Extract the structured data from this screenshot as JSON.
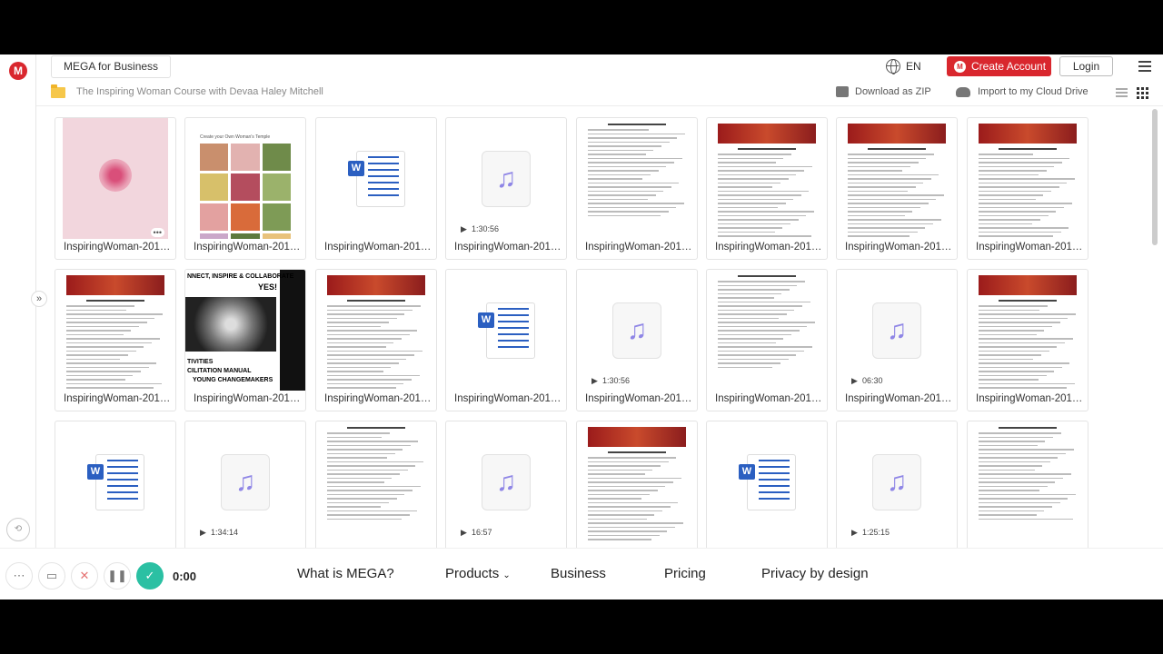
{
  "header": {
    "brand_chip": "MEGA for Business",
    "language": "EN",
    "create_account": "Create Account",
    "login": "Login"
  },
  "breadcrumb": {
    "folder_title": "The Inspiring Woman Course with Devaa Haley Mitchell",
    "download_zip": "Download as ZIP",
    "import": "Import to my Cloud Drive"
  },
  "files": [
    {
      "name": "InspiringWoman-201…",
      "kind": "pink-doc"
    },
    {
      "name": "InspiringWoman-201…",
      "kind": "photos"
    },
    {
      "name": "InspiringWoman-201…",
      "kind": "word"
    },
    {
      "name": "InspiringWoman-201…",
      "kind": "audio",
      "duration": "1:30:56"
    },
    {
      "name": "InspiringWoman-201…",
      "kind": "doc"
    },
    {
      "name": "InspiringWoman-201…",
      "kind": "banner-doc"
    },
    {
      "name": "InspiringWoman-201…",
      "kind": "banner-doc"
    },
    {
      "name": "InspiringWoman-201…",
      "kind": "banner-doc"
    },
    {
      "name": "InspiringWoman-201…",
      "kind": "banner-doc"
    },
    {
      "name": "InspiringWoman-201…",
      "kind": "collage"
    },
    {
      "name": "InspiringWoman-201…",
      "kind": "banner-doc"
    },
    {
      "name": "InspiringWoman-201…",
      "kind": "word"
    },
    {
      "name": "InspiringWoman-201…",
      "kind": "audio",
      "duration": "1:30:56"
    },
    {
      "name": "InspiringWoman-201…",
      "kind": "doc"
    },
    {
      "name": "InspiringWoman-201…",
      "kind": "audio",
      "duration": "06:30"
    },
    {
      "name": "InspiringWoman-201…",
      "kind": "banner-doc"
    },
    {
      "name": "",
      "kind": "word"
    },
    {
      "name": "",
      "kind": "audio",
      "duration": "1:34:14"
    },
    {
      "name": "",
      "kind": "doc"
    },
    {
      "name": "",
      "kind": "audio",
      "duration": "16:57"
    },
    {
      "name": "",
      "kind": "banner-doc"
    },
    {
      "name": "",
      "kind": "word"
    },
    {
      "name": "",
      "kind": "audio",
      "duration": "1:25:15"
    },
    {
      "name": "",
      "kind": "doc"
    }
  ],
  "collage_text": {
    "line1": "NNECT, INSPIRE & COLLABORATE",
    "line2": "YES!",
    "line3": "TIVITIES",
    "line4": "CILITATION MANUAL",
    "line5": "YOUNG CHANGEMAKERS"
  },
  "photo_doc_title": "Create your Own Woman's Temple",
  "footer": {
    "nav": [
      "What is MEGA?",
      "Products",
      "Business",
      "Pricing",
      "Privacy by design"
    ],
    "timer": "0:00"
  },
  "colors": {
    "brand_red": "#d9272e",
    "record_check": "#2bc0a3",
    "audio_note": "#8f86e6",
    "word_blue": "#2b5fc1"
  }
}
